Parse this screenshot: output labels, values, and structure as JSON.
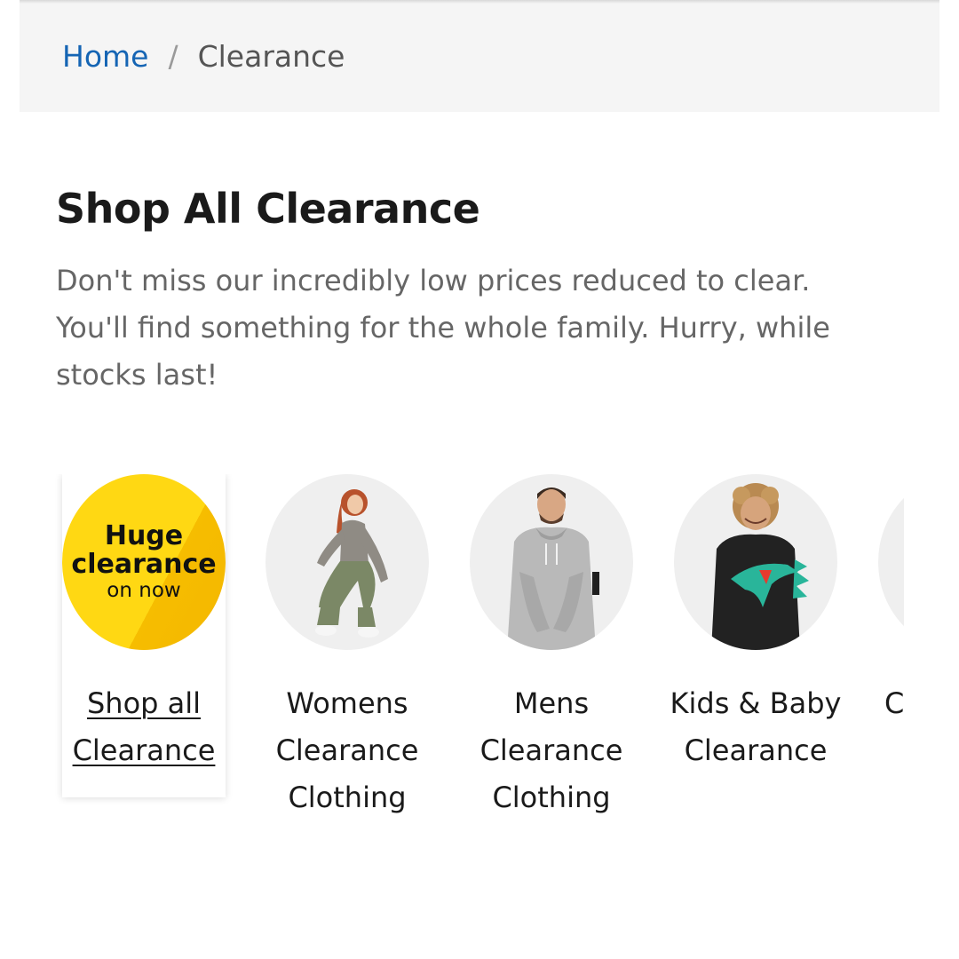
{
  "breadcrumb": {
    "home": "Home",
    "separator": "/",
    "current": "Clearance"
  },
  "heading": "Shop All Clearance",
  "description": "Don't miss our incredibly low prices reduced to clear. You'll find something for the whole family. Hurry, while stocks last!",
  "promo": {
    "line1": "Huge",
    "line2": "clearance",
    "line3": "on now"
  },
  "categories": [
    {
      "label": "Shop all Clearance",
      "image": "huge-clearance-badge"
    },
    {
      "label": "Womens Clearance Clothing",
      "image": "woman-model-photo"
    },
    {
      "label": "Mens Clearance Clothing",
      "image": "man-model-photo"
    },
    {
      "label": "Kids & Baby Clearance",
      "image": "child-model-photo"
    },
    {
      "label": "C",
      "image": "partial-category-photo"
    }
  ],
  "colors": {
    "link": "#1565b4",
    "promo_yellow": "#ffd813",
    "breadcrumb_bg": "#f5f5f5"
  }
}
